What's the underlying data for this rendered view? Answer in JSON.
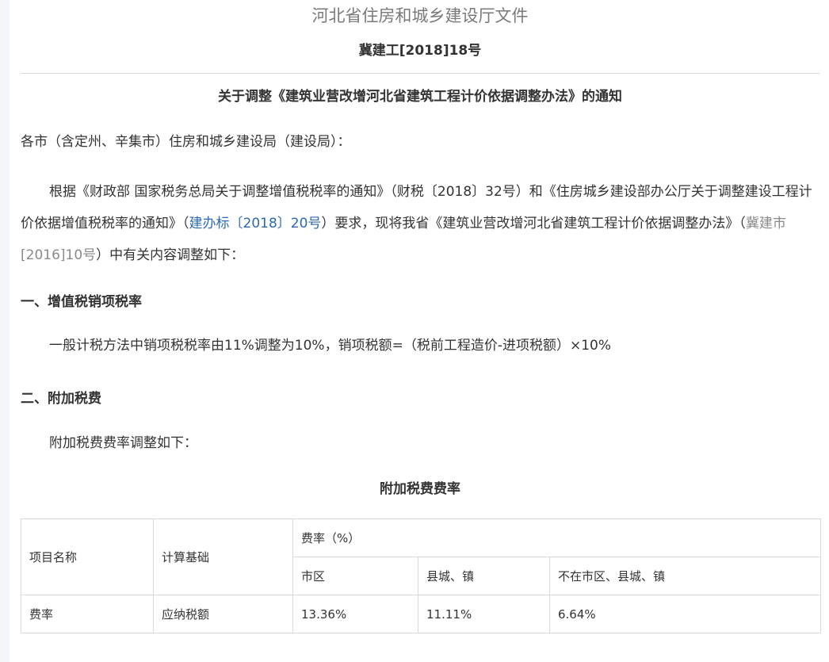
{
  "header": {
    "issuer": "河北省住房和城乡建设厅文件",
    "doc_number": "冀建工[2018]18号"
  },
  "notice_title": "关于调整《建筑业营改增河北省建筑工程计价依据调整办法》的通知",
  "salutation": "各市（含定州、辛集市）住房和城乡建设局（建设局）：",
  "body": {
    "part1": "根据《财政部 国家税务总局关于调整增值税税率的通知》（财税〔2018〕32号）和《住房城乡建设部办公厅关于调整建设工程计价依据增值税税率的通知》（",
    "link1": "建办标〔2018〕20号",
    "part2": "）要求，现将我省《建筑业营改增河北省建筑工程计价依据调整办法》（",
    "link2": "冀建市[2016]10号",
    "part3": "）中有关内容调整如下："
  },
  "section1": {
    "heading": "一、增值税销项税率",
    "text": "一般计税方法中销项税税率由11%调整为10%，销项税额=（税前工程造价-进项税额）×10%"
  },
  "section2": {
    "heading": "二、附加税费",
    "text": "附加税费费率调整如下："
  },
  "table": {
    "caption": "附加税费费率",
    "col_item": "项目名称",
    "col_basis": "计算基础",
    "col_rate_group": "费率（%）",
    "sub_city": "市区",
    "sub_county": "县城、镇",
    "sub_other": "不在市区、县城、镇",
    "row": {
      "item": "费率",
      "basis": "应纳税额",
      "city": "13.36%",
      "county": "11.11%",
      "other": "6.64%"
    }
  },
  "colors": {
    "link_blue": "#2a6ab3",
    "link_gray": "#8a8a8a",
    "issuer_gray": "#7a7a7a",
    "border": "#d9d9d9"
  }
}
